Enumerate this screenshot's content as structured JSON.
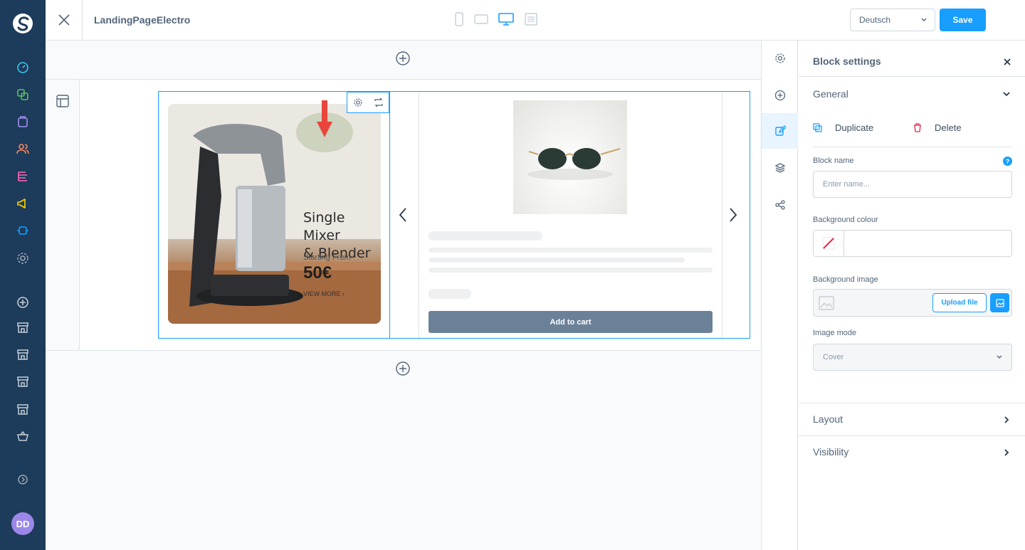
{
  "app": {
    "page_title": "LandingPageElectro",
    "avatar_initials": "DD"
  },
  "topbar": {
    "language": "Deutsch",
    "save_label": "Save"
  },
  "canvas": {
    "banner": {
      "headline_line1": "Single Mixer",
      "headline_line2": "& Blender",
      "subline": "Starting From",
      "price": "50€",
      "cta": "VIEW MORE ›"
    },
    "product": {
      "add_to_cart": "Add to cart"
    }
  },
  "panel": {
    "title": "Block settings",
    "general": "General",
    "duplicate": "Duplicate",
    "delete": "Delete",
    "block_name_label": "Block name",
    "block_name_placeholder": "Enter name...",
    "background_colour_label": "Background colour",
    "background_image_label": "Background image",
    "upload_file": "Upload file",
    "image_mode_label": "Image mode",
    "image_mode_value": "Cover",
    "layout": "Layout",
    "visibility": "Visibility",
    "help": "?"
  },
  "colors": {
    "accent": "#189eff",
    "nav": "#1d3b5a",
    "cart": "#6b8198",
    "arrow": "#e8453c"
  }
}
